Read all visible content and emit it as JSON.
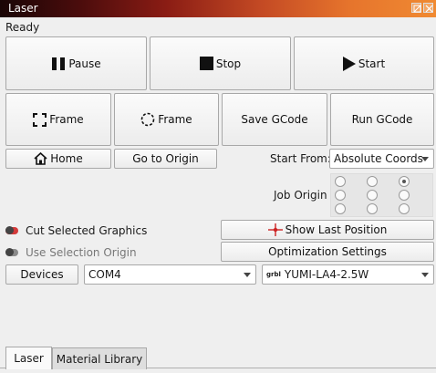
{
  "window": {
    "title": "Laser"
  },
  "status": "Ready",
  "buttons": {
    "pause": "Pause",
    "stop": "Stop",
    "start": "Start",
    "frame_square": "Frame",
    "frame_circle": "Frame",
    "save_gcode": "Save GCode",
    "run_gcode": "Run GCode",
    "home": "Home",
    "go_to_origin": "Go to Origin",
    "show_last_position": "Show Last Position",
    "optimization_settings": "Optimization Settings",
    "devices": "Devices"
  },
  "start_from": {
    "label": "Start From:",
    "value": "Absolute Coords"
  },
  "job_origin": {
    "label": "Job Origin",
    "selected": "top-right"
  },
  "options": {
    "cut_selected_graphics": {
      "label": "Cut Selected Graphics",
      "enabled": true
    },
    "use_selection_origin": {
      "label": "Use Selection Origin",
      "enabled": false
    }
  },
  "port": {
    "value": "COM4"
  },
  "device": {
    "badge": "grbl",
    "value": "YUMI-LA4-2.5W"
  },
  "tabs": [
    {
      "label": "Laser",
      "active": true
    },
    {
      "label": "Material Library",
      "active": false
    }
  ],
  "colors": {
    "accent_red": "#cc2222",
    "toggle_on": "#d43a3a",
    "toggle_off": "#8a8a8a"
  }
}
